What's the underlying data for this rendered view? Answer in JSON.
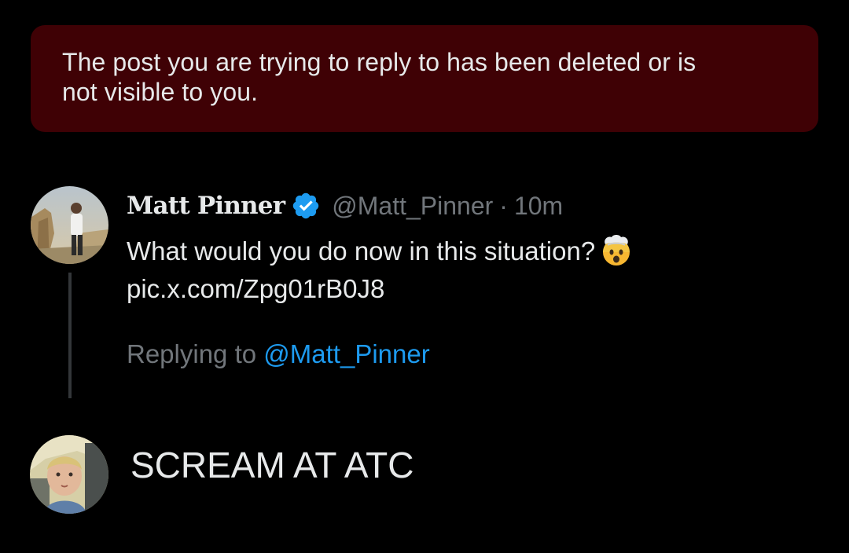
{
  "banner": {
    "message_line1": "The post you are trying to reply to has been deleted or is",
    "message_line2": "not visible to you."
  },
  "parent_post": {
    "display_name": "Matt Pinner",
    "verified": true,
    "handle": "@Matt_Pinner",
    "separator": "·",
    "time": "10m",
    "text_line1": "What would you do now in this situation?",
    "text_line2": "pic.x.com/Zpg01rB0J8",
    "emoji": "exploding-head-icon"
  },
  "replying_to": {
    "prefix": "Replying to",
    "handle": "@Matt_Pinner"
  },
  "composer": {
    "text": "SCREAM AT ATC"
  },
  "colors": {
    "background": "#000000",
    "banner_bg": "#3f0105",
    "primary_text": "#e7e9ea",
    "secondary_text": "#71767b",
    "link": "#1d9bf0",
    "verified": "#1d9bf0",
    "thread_line": "#333639"
  }
}
